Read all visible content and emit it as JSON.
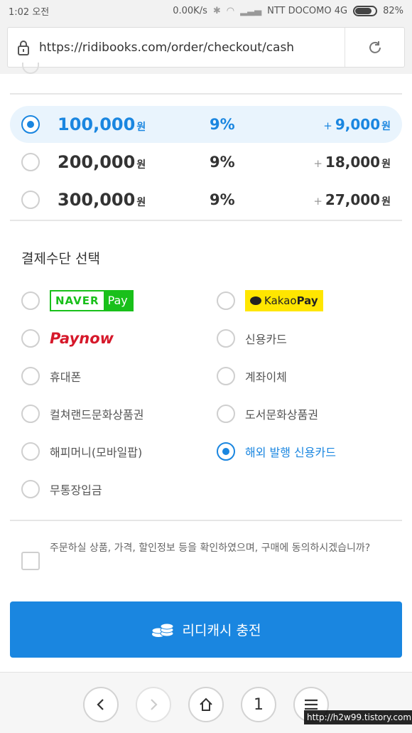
{
  "status_bar": {
    "time": "1:02 오전",
    "network_speed": "0.00K/s",
    "carrier": "NTT DOCOMO 4G",
    "battery": "82%",
    "battery_level": 0.82
  },
  "browser": {
    "url": "https://ridibooks.com/order/checkout/cash"
  },
  "amounts": [
    {
      "amount": "100,000",
      "unit": "원",
      "rate": "9%",
      "plus": "+",
      "bonus": "9,000",
      "bonus_unit": "원",
      "selected": true
    },
    {
      "amount": "200,000",
      "unit": "원",
      "rate": "9%",
      "plus": "+",
      "bonus": "18,000",
      "bonus_unit": "원",
      "selected": false
    },
    {
      "amount": "300,000",
      "unit": "원",
      "rate": "9%",
      "plus": "+",
      "bonus": "27,000",
      "bonus_unit": "원",
      "selected": false
    }
  ],
  "payment": {
    "title": "결제수단 선택",
    "naver": {
      "brand": "NAVER",
      "pay": "Pay"
    },
    "kakao": {
      "brand": "Kakao",
      "pay": "Pay"
    },
    "paynow": "Paynow",
    "methods": [
      {
        "label": "신용카드"
      },
      {
        "label": "휴대폰"
      },
      {
        "label": "계좌이체"
      },
      {
        "label": "컬쳐랜드문화상품권"
      },
      {
        "label": "도서문화상품권"
      },
      {
        "label": "해피머니(모바일팝)"
      },
      {
        "label": "해외 발행 신용카드",
        "selected": true
      },
      {
        "label": "무통장입금"
      }
    ]
  },
  "agreement": {
    "text": "주문하실 상품, 가격, 할인정보 등을 확인하였으며, 구매에 동의하시겠습니까?"
  },
  "charge_button": {
    "label": "리디캐시 충전"
  },
  "nav": {
    "tab_count": "1"
  },
  "watermark": "http://h2w99.tistory.com"
}
